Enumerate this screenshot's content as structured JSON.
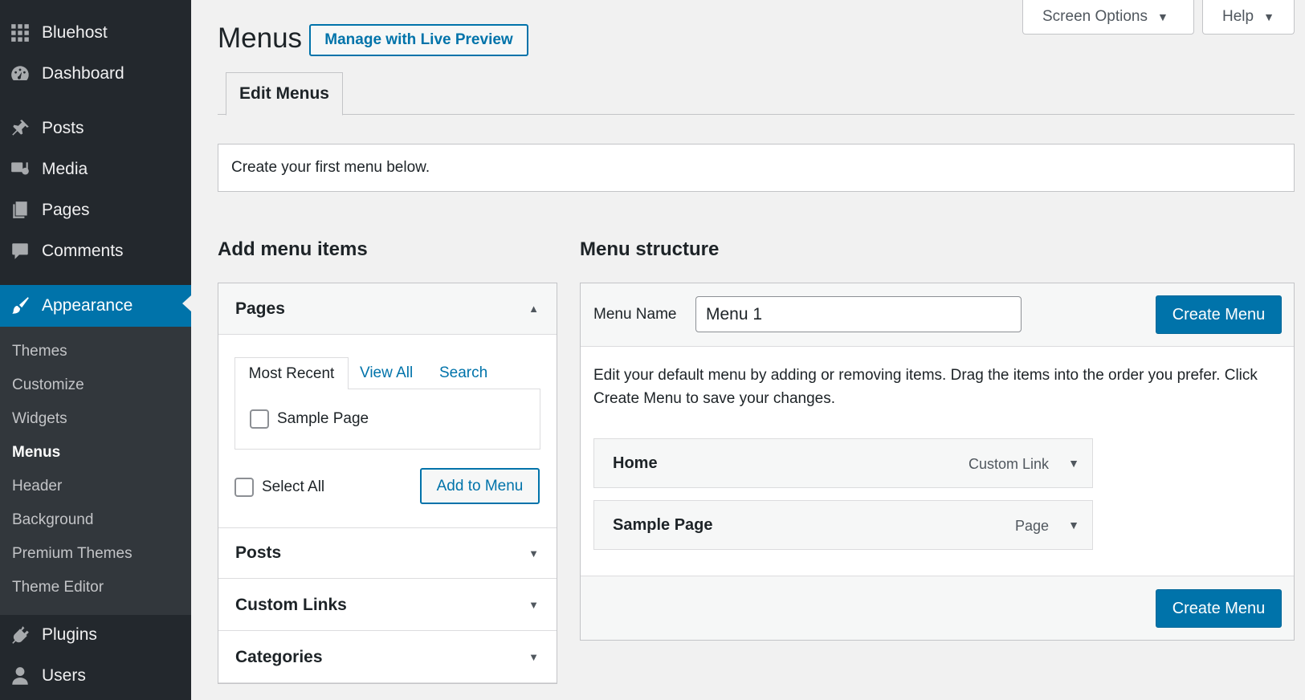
{
  "sidebar": {
    "items": [
      {
        "label": "Bluehost",
        "icon": "grid-icon"
      },
      {
        "label": "Dashboard",
        "icon": "dashboard-icon"
      },
      {
        "label": "Posts",
        "icon": "pin-icon"
      },
      {
        "label": "Media",
        "icon": "media-icon"
      },
      {
        "label": "Pages",
        "icon": "pages-icon"
      },
      {
        "label": "Comments",
        "icon": "comment-icon"
      },
      {
        "label": "Appearance",
        "icon": "paintbrush-icon"
      },
      {
        "label": "Plugins",
        "icon": "plugin-icon"
      },
      {
        "label": "Users",
        "icon": "user-icon"
      }
    ],
    "submenu": [
      "Themes",
      "Customize",
      "Widgets",
      "Menus",
      "Header",
      "Background",
      "Premium Themes",
      "Theme Editor"
    ],
    "active_item": "Appearance",
    "current_submenu": "Menus"
  },
  "header": {
    "title": "Menus",
    "live_preview_label": "Manage with Live Preview",
    "screen_options_label": "Screen Options",
    "help_label": "Help"
  },
  "tabs": {
    "edit_menus": "Edit Menus"
  },
  "notice": {
    "text": "Create your first menu below."
  },
  "add_items": {
    "heading": "Add menu items",
    "pages": {
      "title": "Pages",
      "tabs": [
        "Most Recent",
        "View All",
        "Search"
      ],
      "items": [
        "Sample Page"
      ],
      "select_all_label": "Select All",
      "add_button_label": "Add to Menu"
    },
    "sections": [
      "Posts",
      "Custom Links",
      "Categories"
    ]
  },
  "menu_structure": {
    "heading": "Menu structure",
    "name_label": "Menu Name",
    "name_value": "Menu 1",
    "create_button_label": "Create Menu",
    "instructions": "Edit your default menu by adding or removing items. Drag the items into the order you prefer. Click Create Menu to save your changes.",
    "items": [
      {
        "title": "Home",
        "type": "Custom Link"
      },
      {
        "title": "Sample Page",
        "type": "Page"
      }
    ]
  },
  "colors": {
    "sidebar_bg": "#23282d",
    "submenu_bg": "#32373c",
    "accent": "#0073aa",
    "page_bg": "#f1f1f1"
  }
}
